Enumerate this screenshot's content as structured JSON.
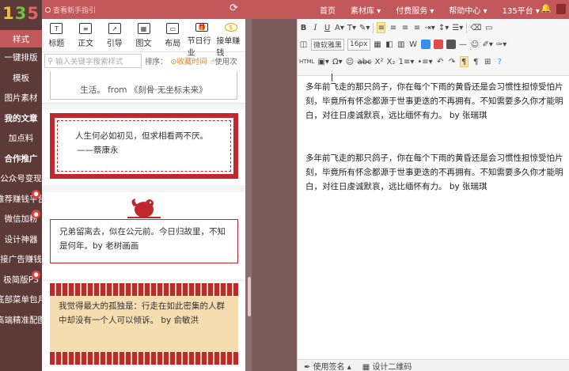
{
  "logo": {
    "l1": "1",
    "l2": "3",
    "l3": "5"
  },
  "leftnav": {
    "items": [
      "样式",
      "一键排版",
      "模板",
      "图片素材",
      "我的文章",
      "加点料",
      "合作推广",
      "公众号变现",
      "推荐赚钱平台",
      "微信加粉",
      "设计神器",
      "接广告赚钱",
      "极简版PS",
      "底部菜单包月",
      "高端精准配图"
    ]
  },
  "topbar": {
    "notice": "查看新手指引",
    "menu": [
      "首页",
      "素材库 ▾",
      "付费服务 ▾",
      "帮助中心 ▾",
      "135平台 ▾"
    ]
  },
  "tabs": [
    {
      "label": "标题",
      "icon": "T"
    },
    {
      "label": "正文",
      "icon": "≡"
    },
    {
      "label": "引导",
      "icon": "➚"
    },
    {
      "label": "图文",
      "icon": "▦"
    },
    {
      "label": "布局",
      "icon": "▭"
    },
    {
      "label": "节日行业",
      "icon": "🎁"
    },
    {
      "label": "接单赚钱",
      "icon": "$"
    }
  ],
  "search": {
    "placeholder": "输入关键字搜索样式",
    "sort_label": "排序：",
    "fav": "收藏时间",
    "used": "使用次"
  },
  "cards": {
    "c0": "生活。 from 《刻骨·无坐标未来》",
    "c1_l1": "人生何必如初见，但求相看两不厌。",
    "c1_l2": "——蔡康永",
    "c2": "兄弟留离去，似在公元前。今日归故里，不知是何年。by 老树画画",
    "c3": "我觉得最大的孤独是：行走在如此密集的人群中却没有一个人可以倾诉。 by 俞敏洪"
  },
  "editor": {
    "font": "微软雅黑",
    "size": "16px",
    "para1": "多年前飞走的那只鸽子，你在每个下雨的黄昏还是会习惯性担惊受怕片刻，毕竟所有怀念都源于世事更迭的不再拥有。不知需要多久你才能明白，对往日虔诚默哀，远比缅怀有力。 by 张瑞琪",
    "para2": "多年前飞走的那只鸽子，你在每个下雨的黄昏还是会习惯性担惊受怕片刻，毕竟所有怀念都源于世事更迭的不再拥有。不知需要多久你才能明白，对往日虔诚默哀，远比缅怀有力。 by 张瑞琪",
    "bottom_sign": "使用签名 ▴",
    "bottom_qr": "设计二维码"
  },
  "colors": {
    "accent": "#c2585a",
    "nav_bg": "#5b3a37",
    "red_frame": "#c0282e"
  }
}
